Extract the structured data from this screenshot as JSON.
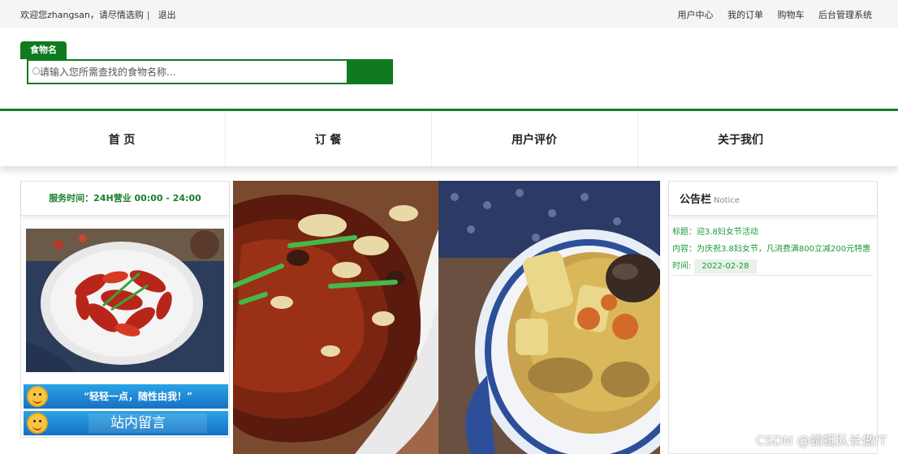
{
  "topbar": {
    "welcome": "欢迎您zhangsan，请尽情选购",
    "separator": "|",
    "logout": "退出",
    "links": [
      "用户中心",
      "我的订单",
      "购物车",
      "后台管理系统"
    ]
  },
  "search": {
    "tab_label": "食物名",
    "placeholder": "请输入您所需查找的食物名称..."
  },
  "nav": {
    "items": [
      "首 页",
      "订 餐",
      "用户评价",
      "关于我们"
    ]
  },
  "left_panel": {
    "hours": "服务时间：24H营业 00:00 - 24:00",
    "banner1": "“轻轻一点，随性由我！”",
    "banner2": "站内留言"
  },
  "notice": {
    "title": "公告栏",
    "title_en": "Notice",
    "subject": "标题：迎3.8妇女节活动",
    "content": "内容：为庆祝3.8妇女节，凡消费满800立减200元特惠",
    "date_label": "时间:",
    "date": "2022-02-28"
  },
  "watermark": "CSDN @蜻蜓队长做IT",
  "colors": {
    "brand_green": "#0f7a1f",
    "notice_text": "#1a9a3a"
  }
}
